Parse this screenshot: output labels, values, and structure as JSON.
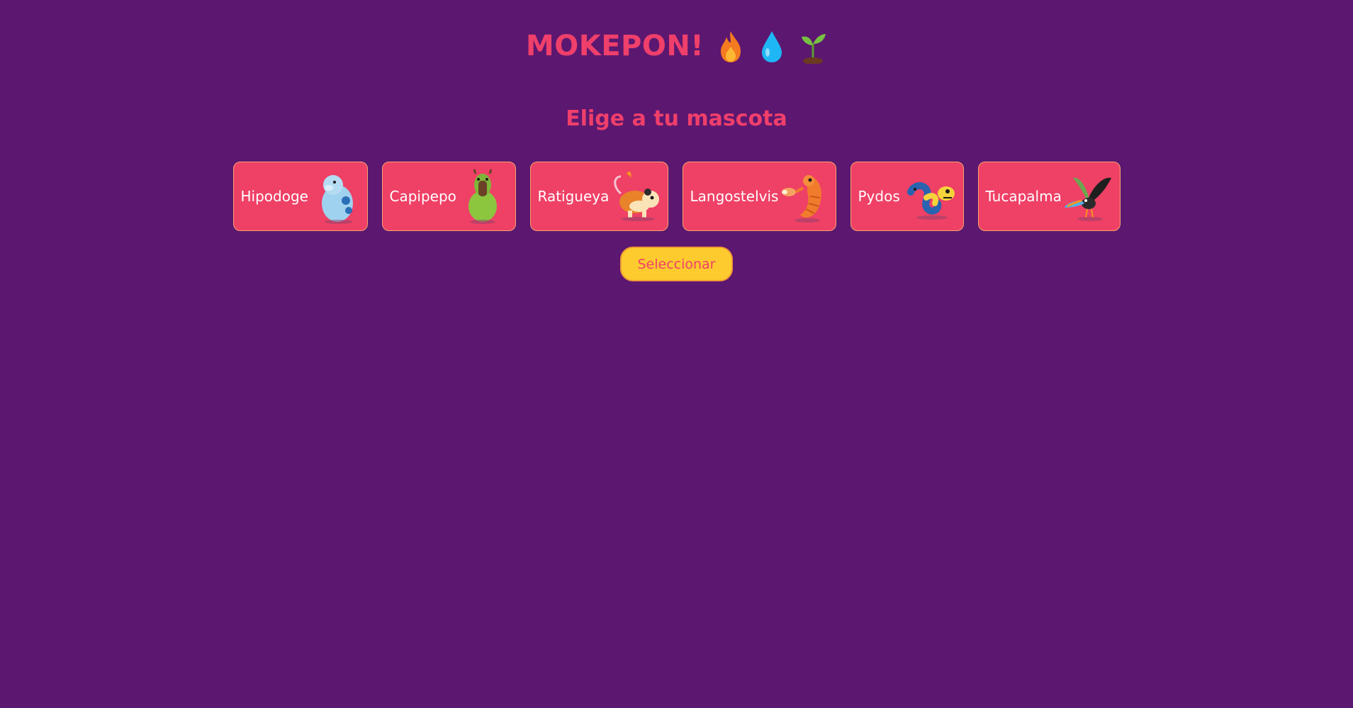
{
  "header": {
    "title": "MOKEPON!",
    "icons": [
      "fire-icon",
      "water-drop-icon",
      "sprout-icon"
    ]
  },
  "subtitle": "Elige a tu mascota",
  "pets": [
    {
      "name": "Hipodoge",
      "icon": "hipodoge-icon"
    },
    {
      "name": "Capipepo",
      "icon": "capipepo-icon"
    },
    {
      "name": "Ratigueya",
      "icon": "ratigueya-icon"
    },
    {
      "name": "Langostelvis",
      "icon": "langostelvis-icon"
    },
    {
      "name": "Pydos",
      "icon": "pydos-icon"
    },
    {
      "name": "Tucapalma",
      "icon": "tucapalma-icon"
    }
  ],
  "select_button": {
    "label": "Seleccionar"
  },
  "colors": {
    "background": "#5c1770",
    "title": "#ef3f6b",
    "card": "#ef4066",
    "card_border": "#f7a46b",
    "button": "#fdcb2e"
  }
}
